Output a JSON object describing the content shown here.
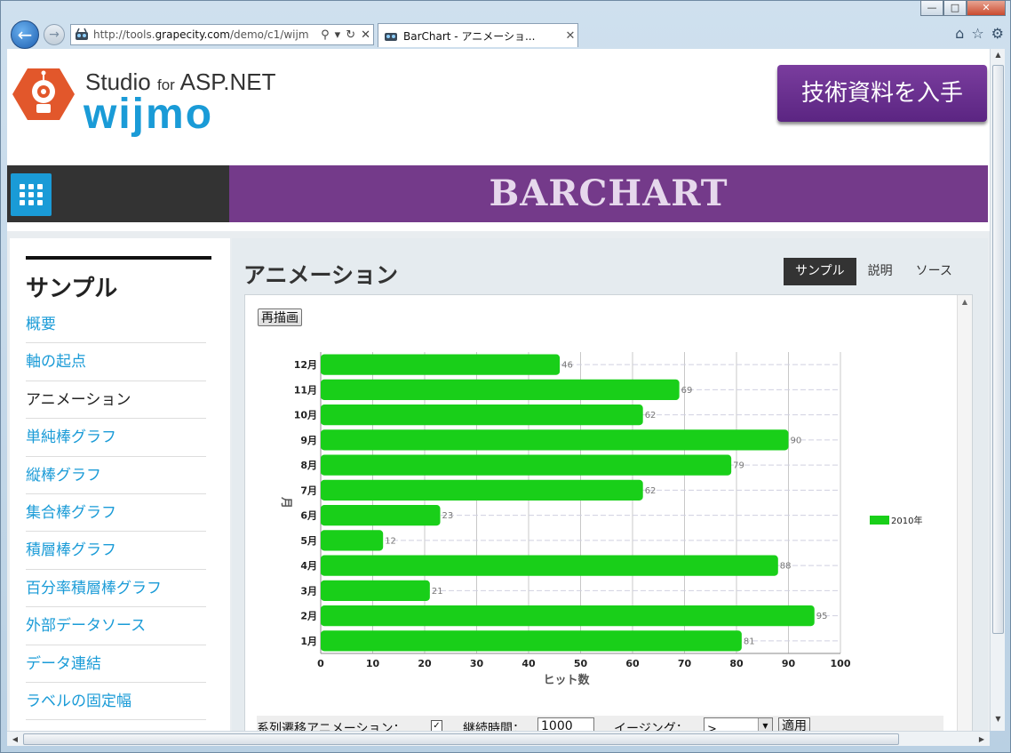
{
  "browser": {
    "url_prefix": "http://tools.",
    "url_domain": "grapecity.com",
    "url_suffix": "/demo/c1/wijm",
    "tab_title": "BarChart - アニメーショ...",
    "minimize": "—",
    "maximize": "□",
    "close": "✕"
  },
  "header": {
    "logo_top": "Studio",
    "logo_for": "for",
    "logo_asp": "ASP.NET",
    "logo_main": "wijmo",
    "cta_label": "技術資料を入手",
    "banner_title": "BARCHART"
  },
  "sidebar": {
    "title": "サンプル",
    "items": [
      {
        "label": "概要"
      },
      {
        "label": "軸の起点"
      },
      {
        "label": "アニメーション"
      },
      {
        "label": "単純棒グラフ"
      },
      {
        "label": "縦棒グラフ"
      },
      {
        "label": "集合棒グラフ"
      },
      {
        "label": "積層棒グラフ"
      },
      {
        "label": "百分率積層棒グラフ"
      },
      {
        "label": "外部データソース"
      },
      {
        "label": "データ連結"
      },
      {
        "label": "ラベルの固定幅"
      }
    ]
  },
  "main": {
    "title": "アニメーション",
    "tabs": [
      {
        "label": "サンプル"
      },
      {
        "label": "説明"
      },
      {
        "label": "ソース"
      }
    ],
    "redraw_label": "再描画"
  },
  "controls": {
    "series_anim_label": "系列遷移アニメーション：",
    "series_anim_checked": "✓",
    "duration_label": "継続時間：",
    "duration_value": "1000",
    "easing_label": "イージング：",
    "easing_value": ">",
    "apply_label": "適用"
  },
  "colors": {
    "bar": "#19cf19",
    "banner": "#743a8a",
    "accent": "#1a9bd7"
  },
  "chart_data": {
    "type": "bar",
    "orientation": "horizontal",
    "categories": [
      "1月",
      "2月",
      "3月",
      "4月",
      "5月",
      "6月",
      "7月",
      "8月",
      "9月",
      "10月",
      "11月",
      "12月"
    ],
    "series": [
      {
        "name": "2010年",
        "values": [
          81,
          95,
          21,
          88,
          12,
          23,
          62,
          79,
          90,
          62,
          69,
          46
        ]
      }
    ],
    "xlabel": "ヒット数",
    "ylabel": "月",
    "xlim": [
      0,
      100
    ],
    "x_ticks": [
      0,
      10,
      20,
      30,
      40,
      50,
      60,
      70,
      80,
      90,
      100
    ],
    "grid": true,
    "legend": "right",
    "data_labels": true
  }
}
